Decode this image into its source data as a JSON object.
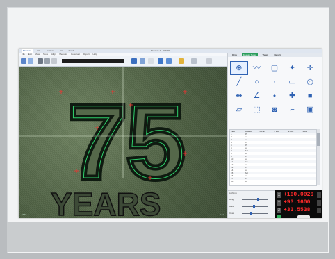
{
  "app": {
    "title": "Measure-X - SMART",
    "tabs": [
      "Measure",
      "File",
      "Feature",
      "Fit",
      "Finish"
    ]
  },
  "menu": [
    "File",
    "Edit",
    "View",
    "Tools",
    "Align",
    "Measure",
    "Construct",
    "Report",
    "Help"
  ],
  "toolbar": {
    "field_text": ""
  },
  "viewport": {
    "text_big": "75",
    "text_small": "YEARS",
    "status_left": "100x",
    "status_right": "Live"
  },
  "panel": {
    "tabs": [
      "Dims",
      "Feature Types",
      "Views",
      "Reports"
    ],
    "active_tab_index": 1,
    "tools": [
      {
        "name": "crosshair-icon",
        "glyph": "⊕"
      },
      {
        "name": "waveform-icon",
        "glyph": "〰"
      },
      {
        "name": "square-icon",
        "glyph": "▢"
      },
      {
        "name": "point-icon",
        "glyph": "✦"
      },
      {
        "name": "plus-icon",
        "glyph": "✛"
      },
      {
        "name": "line-icon",
        "glyph": "╱"
      },
      {
        "name": "circle-icon",
        "glyph": "○"
      },
      {
        "name": "dot-icon",
        "glyph": "·"
      },
      {
        "name": "slot-icon",
        "glyph": "▭"
      },
      {
        "name": "cylinder-icon",
        "glyph": "◎"
      },
      {
        "name": "width-icon",
        "glyph": "⇹"
      },
      {
        "name": "angle-icon",
        "glyph": "∠"
      },
      {
        "name": "node-icon",
        "glyph": "⬩"
      },
      {
        "name": "intersect-icon",
        "glyph": "✚"
      },
      {
        "name": "block-icon",
        "glyph": "■"
      },
      {
        "name": "plane-icon",
        "glyph": "▱"
      },
      {
        "name": "box-icon",
        "glyph": "⬚"
      },
      {
        "name": "camera-icon",
        "glyph": "◙"
      },
      {
        "name": "profile-icon",
        "glyph": "⌐"
      },
      {
        "name": "monitor-icon",
        "glyph": "▣"
      }
    ],
    "table": {
      "headers": [
        "Feat",
        "Feature",
        "X Loc",
        "Y Loc",
        "Z Loc",
        "Size"
      ],
      "rows": [
        [
          "1",
          "Pt",
          "",
          "",
          "",
          ""
        ],
        [
          "2",
          "Ln",
          "",
          "",
          "",
          ""
        ],
        [
          "3",
          "Ln",
          "",
          "",
          "",
          ""
        ],
        [
          "4",
          "Cir",
          "",
          "",
          "",
          ""
        ],
        [
          "5",
          "Pt",
          "",
          "",
          "",
          ""
        ],
        [
          "6",
          "Ln",
          "",
          "",
          "",
          ""
        ],
        [
          "7",
          "Arc",
          "",
          "",
          "",
          ""
        ],
        [
          "8",
          "Ln",
          "",
          "",
          "",
          ""
        ],
        [
          "9",
          "Pt",
          "",
          "",
          "",
          ""
        ],
        [
          "10",
          "Ln",
          "",
          "",
          "",
          ""
        ],
        [
          "11",
          "Cir",
          "",
          "",
          "",
          ""
        ],
        [
          "12",
          "Ln",
          "",
          "",
          "",
          ""
        ],
        [
          "13",
          "Pt",
          "",
          "",
          "",
          ""
        ],
        [
          "14",
          "Ln",
          "",
          "",
          "",
          ""
        ],
        [
          "15",
          "Arc",
          "",
          "",
          "",
          ""
        ],
        [
          "16",
          "Ln",
          "",
          "",
          "",
          ""
        ],
        [
          "17",
          "Pt",
          "",
          "",
          "",
          ""
        ],
        [
          "18",
          "Ln",
          "",
          "",
          "",
          ""
        ]
      ]
    },
    "light": {
      "title": "Lighting",
      "labels": [
        "Ring",
        "Back",
        "Coax"
      ],
      "levels": [
        0.62,
        0.45,
        0.3
      ]
    },
    "dro": {
      "values": [
        "+100.0026",
        "+93.1600",
        "+33.5538"
      ]
    }
  },
  "colors": {
    "accent": "#2a9d5c",
    "dro_text": "#ff2a2a"
  }
}
